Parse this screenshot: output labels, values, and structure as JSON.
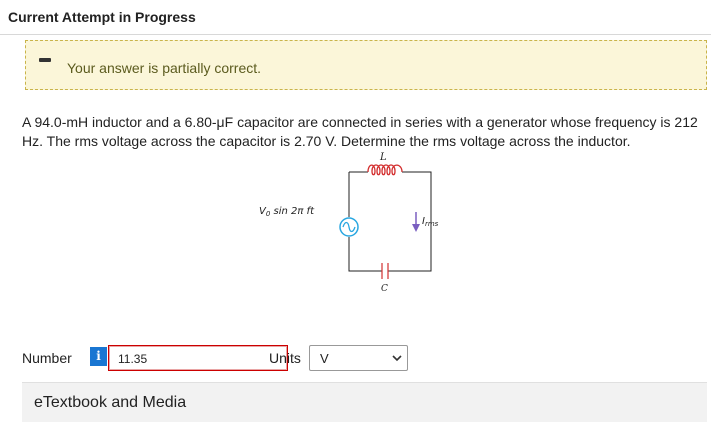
{
  "header": {
    "title": "Current Attempt in Progress"
  },
  "feedback": {
    "icon": "partial-minus-icon",
    "message": "Your answer is partially correct."
  },
  "question": {
    "text": "A 94.0-mH inductor and a 6.80-μF capacitor are connected in series with a generator whose frequency is 212 Hz. The rms voltage across the capacitor is 2.70 V. Determine the rms voltage across the inductor."
  },
  "circuit": {
    "inductor_label": "L",
    "capacitor_label": "C",
    "current_label": "I",
    "current_subscript": "rms",
    "source_label_v": "V",
    "source_label_v_sub": "0",
    "source_label_rest": " sin 2π ft",
    "colors": {
      "inductor": "#d32f2f",
      "source": "#29a7e1",
      "arrow": "#7a5fc0",
      "wire": "#222222"
    }
  },
  "answer": {
    "number_label": "Number",
    "info_icon": "i",
    "value": "11.35",
    "units_label": "Units",
    "units_value": "V"
  },
  "etextbook": {
    "label": "eTextbook and Media"
  }
}
